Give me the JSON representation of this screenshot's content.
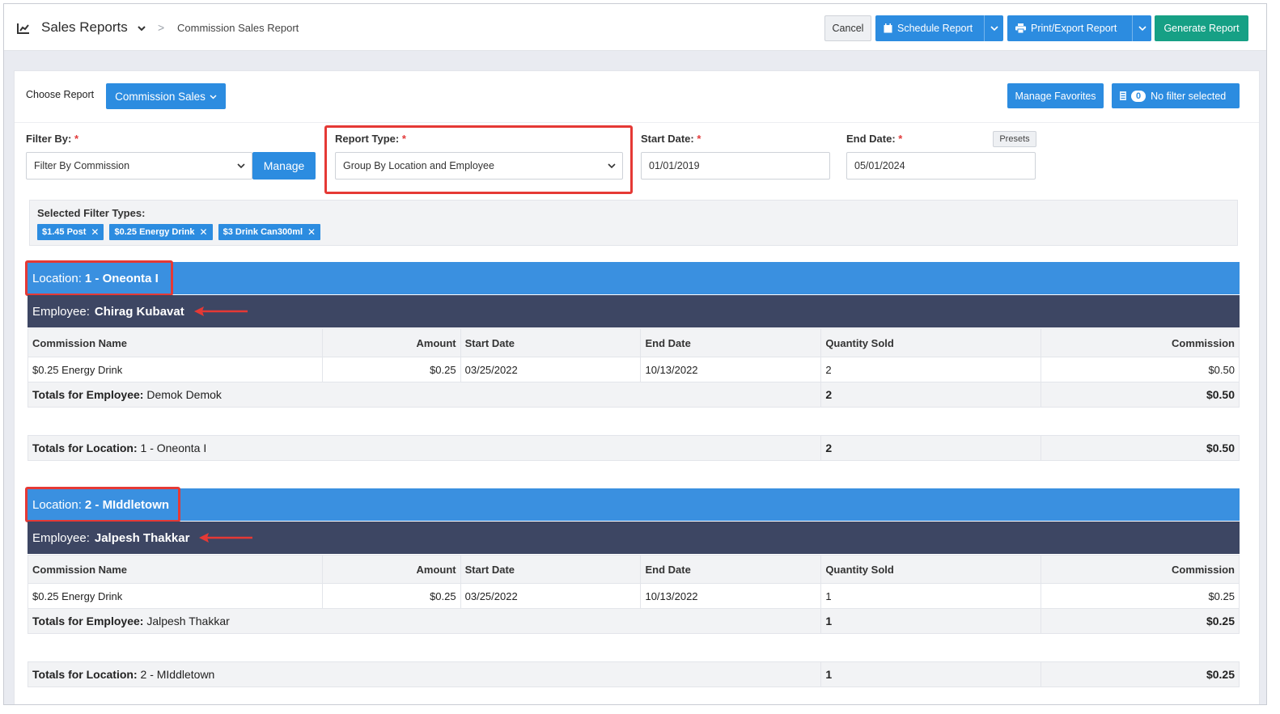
{
  "header": {
    "app_title": "Sales Reports",
    "breadcrumb_sep": ">",
    "breadcrumb": "Commission Sales Report",
    "cancel": "Cancel",
    "schedule": "Schedule Report",
    "print_export": "Print/Export Report",
    "generate": "Generate Report"
  },
  "toolbar": {
    "choose_label": "Choose Report",
    "choose_value": "Commission Sales",
    "manage_favorites": "Manage Favorites",
    "filter_count": "0",
    "no_filter": "No filter selected"
  },
  "filters": {
    "filter_by_label": "Filter By:",
    "filter_by_value": "Filter By Commission",
    "manage": "Manage",
    "report_type_label": "Report Type:",
    "report_type_value": "Group By Location and Employee",
    "start_label": "Start Date:",
    "start_value": "01/01/2019",
    "end_label": "End Date:",
    "end_value": "05/01/2024",
    "presets": "Presets",
    "required": "*"
  },
  "selected_filters": {
    "label": "Selected Filter Types:",
    "chips": [
      "$1.45 Post",
      "$0.25 Energy Drink",
      "$3 Drink Can300ml"
    ]
  },
  "columns": [
    "Commission Name",
    "Amount",
    "Start Date",
    "End Date",
    "Quantity Sold",
    "Commission"
  ],
  "labels": {
    "location": "Location:",
    "employee": "Employee:",
    "totals_employee": "Totals for Employee:",
    "totals_location": "Totals for Location:"
  },
  "groups": [
    {
      "location": "1 - Oneonta I",
      "employee": "Chirag Kubavat",
      "row": {
        "name": "$0.25 Energy Drink",
        "amount": "$0.25",
        "start": "03/25/2022",
        "end": "10/13/2022",
        "qty": "2",
        "commission": "$0.50"
      },
      "emp_total_name": "Demok Demok",
      "emp_total_qty": "2",
      "emp_total_comm": "$0.50",
      "loc_total_name": "1 - Oneonta I",
      "loc_total_qty": "2",
      "loc_total_comm": "$0.50"
    },
    {
      "location": "2 - MIddletown",
      "employee": "Jalpesh Thakkar",
      "row": {
        "name": "$0.25 Energy Drink",
        "amount": "$0.25",
        "start": "03/25/2022",
        "end": "10/13/2022",
        "qty": "1",
        "commission": "$0.25"
      },
      "emp_total_name": "Jalpesh Thakkar",
      "emp_total_qty": "1",
      "emp_total_comm": "$0.25",
      "loc_total_name": "2 - MIddletown",
      "loc_total_qty": "1",
      "loc_total_comm": "$0.25"
    }
  ],
  "icons": {
    "chart": "line-chart-icon",
    "calendar": "calendar-icon",
    "printer": "printer-icon",
    "filter": "filter-icon",
    "remove": "close-icon"
  },
  "colors": {
    "primary": "#2c8ce0",
    "success": "#16a085",
    "location_bar": "#3a90e0",
    "employee_bar": "#3d4663",
    "highlight": "#e53935"
  }
}
